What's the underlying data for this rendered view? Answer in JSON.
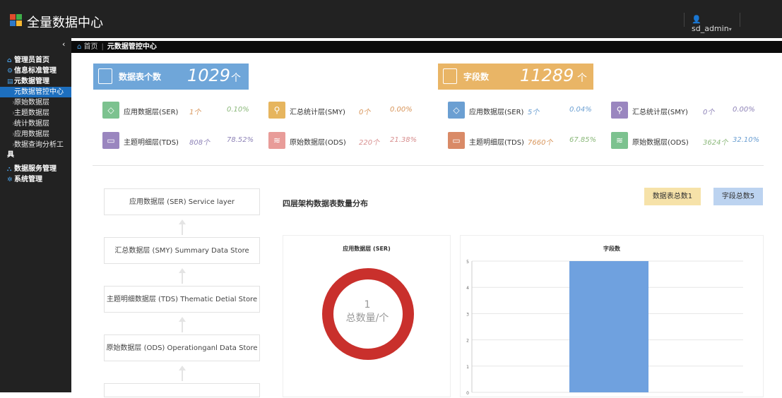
{
  "header": {
    "app_title": "全量数据中心",
    "user_name": "sd_admin",
    "user_caret": "▾",
    "logo_colors": [
      "#e04b2c",
      "#3fae49",
      "#2f79c7",
      "#f7b731"
    ]
  },
  "sidebar": {
    "collapse_icon": "‹",
    "items": [
      {
        "label": "管理员首页",
        "icon": "home-icon"
      },
      {
        "label": "信息标准管理",
        "icon": "gear-icon"
      },
      {
        "label": "元数据管理",
        "icon": "database-icon"
      }
    ],
    "sub_items": [
      {
        "label": "元数据管控中心",
        "active": true
      },
      {
        "label": "原始数据层"
      },
      {
        "label": "主题数据层"
      },
      {
        "label": "统计数据层"
      },
      {
        "label": "应用数据层"
      },
      {
        "label": "数据查询分析工"
      }
    ],
    "sub_wrap": "具",
    "bottom_items": [
      {
        "label": "数据服务管理",
        "icon": "network-icon"
      },
      {
        "label": "系统管理",
        "icon": "cog-icon"
      }
    ]
  },
  "breadcrumb": {
    "home": "首页",
    "current": "元数据管控中心"
  },
  "kpis": {
    "tables": {
      "label": "数据表个数",
      "value": "1029",
      "unit": "个",
      "color": "#6fa6d9"
    },
    "fields": {
      "label": "字段数",
      "value": "11289",
      "unit": "个",
      "color": "#e9b566"
    }
  },
  "table_stats": [
    {
      "name": "应用数据层(SER)",
      "count": "1个",
      "pct": "0.10%",
      "color": "#7cc28f",
      "count_color": "#d8955a",
      "pct_color": "#8bb87a",
      "icon": "◇"
    },
    {
      "name": "汇总统计层(SMY)",
      "count": "0个",
      "pct": "0.00%",
      "color": "#e6b55e",
      "count_color": "#d8955a",
      "pct_color": "#d8955a",
      "icon": "⚲"
    },
    {
      "name": "主题明细层(TDS)",
      "count": "808个",
      "pct": "78.52%",
      "color": "#9a86bf",
      "count_color": "#8f84b8",
      "pct_color": "#8f84b8",
      "icon": "▭"
    },
    {
      "name": "原始数据层(ODS)",
      "count": "220个",
      "pct": "21.38%",
      "color": "#e89c99",
      "count_color": "#d88f8f",
      "pct_color": "#d88f8f",
      "icon": "≋"
    }
  ],
  "field_stats": [
    {
      "name": "应用数据层(SER)",
      "count": "5个",
      "pct": "0.04%",
      "color": "#6b9fd2",
      "count_color": "#6b9fd2",
      "pct_color": "#6b9fd2",
      "icon": "◇"
    },
    {
      "name": "汇总统计层(SMY)",
      "count": "0个",
      "pct": "0.00%",
      "color": "#9a86bf",
      "count_color": "#8f84b8",
      "pct_color": "#8f84b8",
      "icon": "⚲"
    },
    {
      "name": "主题明细层(TDS)",
      "count": "7660个",
      "pct": "67.85%",
      "color": "#d98a67",
      "count_color": "#d8955a",
      "pct_color": "#8bb87a",
      "icon": "▭"
    },
    {
      "name": "原始数据层(ODS)",
      "count": "3624个",
      "pct": "32.10%",
      "color": "#7cc28f",
      "count_color": "#8bb87a",
      "pct_color": "#6b9fd2",
      "icon": "≋"
    }
  ],
  "layers": [
    "应用数据层 (SER) Service layer",
    "汇总数据层 (SMY) Summary Data Store",
    "主题明细数据层 (TDS) Thematic Detial Store",
    "原始数据层 (ODS) Operationganl Data Store"
  ],
  "section_title": "四层架构数据表数量分布",
  "buttons": {
    "table_total": "数据表总数1",
    "field_total": "字段总数5"
  },
  "donut": {
    "title": "应用数据层 (SER)",
    "value": "1",
    "caption": "总数量/个",
    "color": "#c9302c"
  },
  "chart_data": {
    "type": "bar",
    "title": "字段数",
    "categories": [
      ""
    ],
    "values": [
      5
    ],
    "ylim": [
      0,
      5
    ],
    "yticks": [
      "5",
      "4",
      "3",
      "2",
      "1",
      "0"
    ],
    "color": "#6fa1df",
    "grid": true
  }
}
